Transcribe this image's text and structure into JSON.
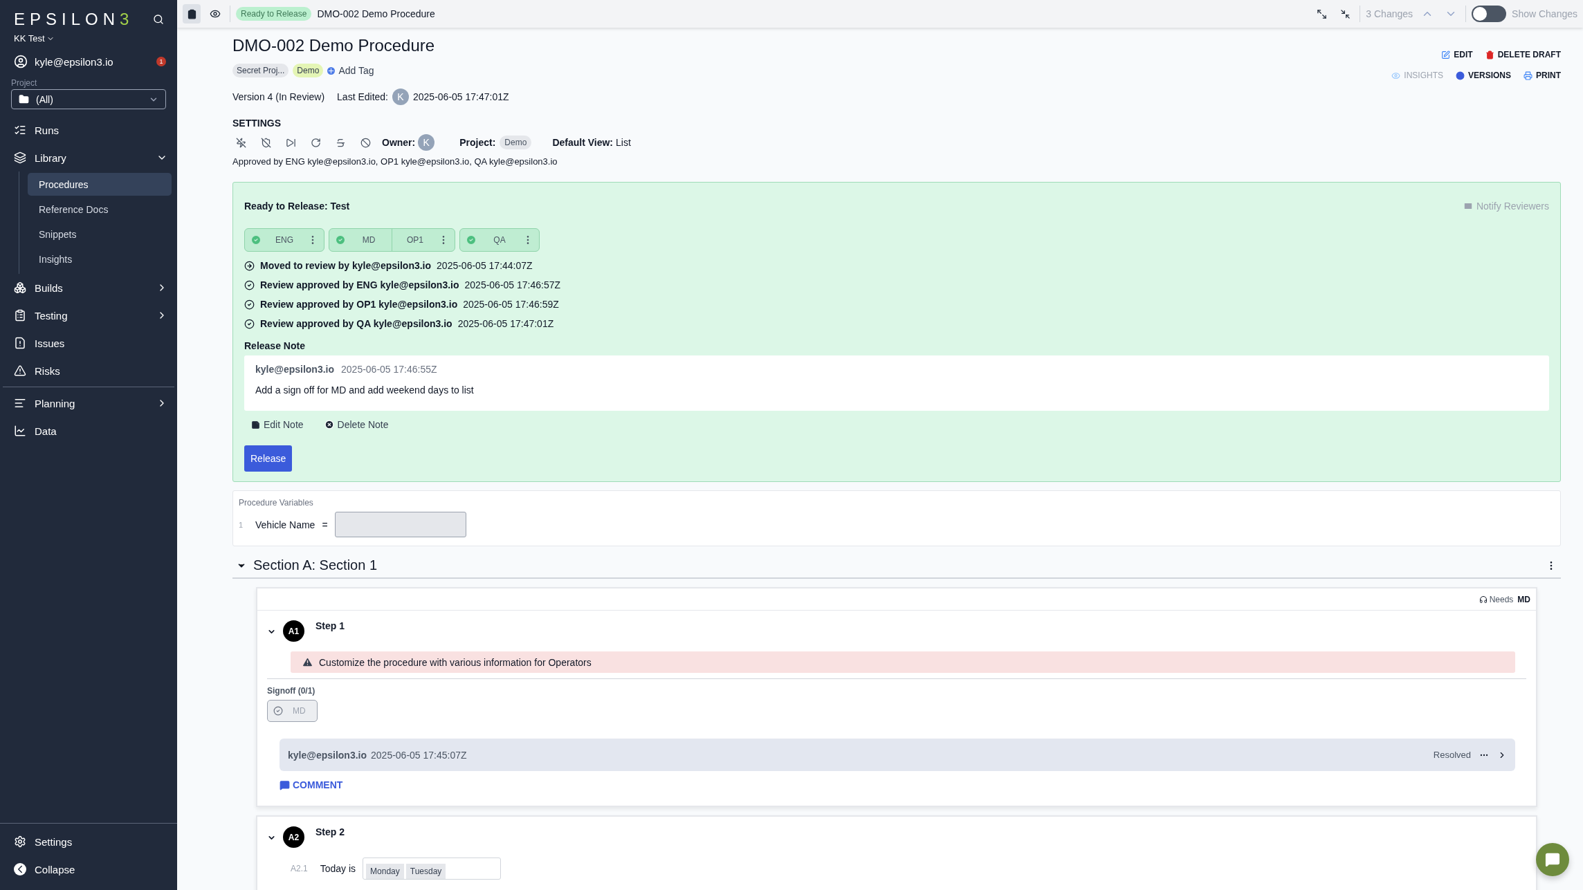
{
  "sidebar": {
    "logo": {
      "text": "EPSILON",
      "mark": "3"
    },
    "workspace": "KK Test",
    "user": {
      "email": "kyle@epsilon3.io",
      "badge": "1"
    },
    "project": {
      "label": "Project",
      "value": "(All)"
    },
    "nav": [
      {
        "kind": "link",
        "label": "Runs",
        "selected": false
      },
      {
        "kind": "group",
        "label": "Library",
        "expanded": true,
        "selected": false,
        "children": [
          {
            "label": "Procedures",
            "selected": true
          },
          {
            "label": "Reference Docs",
            "selected": false
          },
          {
            "label": "Snippets",
            "selected": false
          },
          {
            "label": "Insights",
            "selected": false
          }
        ]
      },
      {
        "kind": "group",
        "label": "Builds",
        "expanded": false,
        "selected": false
      },
      {
        "kind": "group",
        "label": "Testing",
        "expanded": false,
        "selected": false
      },
      {
        "kind": "link",
        "label": "Issues",
        "selected": false
      },
      {
        "kind": "link",
        "label": "Risks",
        "selected": false
      },
      {
        "kind": "divider"
      },
      {
        "kind": "group",
        "label": "Planning",
        "expanded": false,
        "selected": false
      },
      {
        "kind": "link",
        "label": "Data",
        "selected": false
      }
    ],
    "footer": [
      "Settings",
      "Collapse"
    ]
  },
  "toolbar": {
    "status": "Ready to Release",
    "title": "DMO-002 Demo Procedure",
    "changes": "3 Changes",
    "show_changes": {
      "label": "Show Changes",
      "on": false
    }
  },
  "header": {
    "title": "DMO-002 Demo Procedure",
    "tags": [
      {
        "label": "Secret Proj...",
        "color": "#e5e7eb"
      },
      {
        "label": "Demo",
        "color": "#e4f5b5"
      }
    ],
    "add_tag": "Add Tag",
    "actions": [
      {
        "label": "EDIT",
        "kind": "edit",
        "disabled": false
      },
      {
        "label": "DELETE DRAFT",
        "kind": "delete",
        "disabled": false
      }
    ],
    "links": [
      {
        "label": "INSIGHTS",
        "kind": "insights",
        "disabled": true
      },
      {
        "label": "VERSIONS",
        "kind": "versions",
        "disabled": false
      },
      {
        "label": "PRINT",
        "kind": "print",
        "disabled": false
      }
    ],
    "version": "Version 4 (In Review)",
    "last_edited_label": "Last Edited:",
    "last_edited_avatar": "K",
    "last_edited": "2025-06-05 17:47:01Z",
    "settings": {
      "title": "SETTINGS",
      "owner_label": "Owner:",
      "owner_avatar": "K",
      "project_label": "Project:",
      "project": "Demo",
      "view_label": "Default View:",
      "view": "List"
    },
    "approved": "Approved by ENG kyle@epsilon3.io, OP1 kyle@epsilon3.io, QA kyle@epsilon3.io"
  },
  "release": {
    "title": "Ready to Release: Test",
    "notify": "Notify Reviewers",
    "reviewers": [
      [
        {
          "label": "ENG",
          "approved": true
        }
      ],
      [
        {
          "label": "MD",
          "approved": true
        },
        {
          "label": "OP1",
          "approved": false
        }
      ],
      [
        {
          "label": "QA",
          "approved": true
        }
      ]
    ],
    "log": [
      {
        "kind": "moved",
        "text": "Moved to review by kyle@epsilon3.io",
        "time": "2025-06-05 17:44:07Z"
      },
      {
        "kind": "approved",
        "text": "Review approved by ENG kyle@epsilon3.io",
        "time": "2025-06-05 17:46:57Z"
      },
      {
        "kind": "approved",
        "text": "Review approved by OP1 kyle@epsilon3.io",
        "time": "2025-06-05 17:46:59Z"
      },
      {
        "kind": "approved",
        "text": "Review approved by QA kyle@epsilon3.io",
        "time": "2025-06-05 17:47:01Z"
      }
    ],
    "note_label": "Release Note",
    "note": {
      "author": "kyle@epsilon3.io",
      "time": "2025-06-05 17:46:55Z",
      "body": "Add a sign off for MD and add weekend days to list"
    },
    "edit_note": "Edit Note",
    "delete_note": "Delete Note",
    "button": "Release"
  },
  "variables": {
    "title": "Procedure Variables",
    "rows": [
      {
        "index": "1",
        "name": "Vehicle Name",
        "op": "="
      }
    ]
  },
  "section": {
    "title": "Section A: Section 1",
    "expanded": true,
    "steps": [
      {
        "badge": "A1",
        "title": "Step 1",
        "expanded": true,
        "needs_label": "Needs",
        "needs": "MD",
        "warning": "Customize the procedure with various information for Operators",
        "signoff_label": "Signoff (0/1)",
        "signoffs": [
          {
            "label": "MD",
            "checked": false
          }
        ],
        "comment": {
          "author": "kyle@epsilon3.io",
          "time": "2025-06-05 17:45:07Z",
          "status": "Resolved"
        },
        "comment_button": "COMMENT"
      },
      {
        "badge": "A2",
        "title": "Step 2",
        "expanded": true,
        "items": [
          {
            "index": "A2.1",
            "label": "Today is",
            "options": [
              "Monday",
              "Tuesday"
            ]
          }
        ]
      }
    ]
  }
}
